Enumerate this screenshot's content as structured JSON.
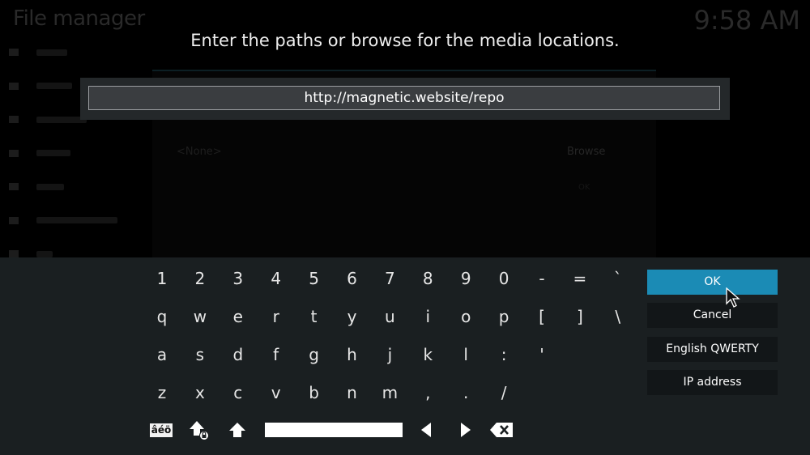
{
  "background": {
    "title": "File manager",
    "clock": "9:58 AM",
    "sidebar_item_count": 7,
    "dialog": {
      "source_value": "<None>",
      "browse_label": "Browse",
      "ok_label": "OK"
    }
  },
  "dialog": {
    "heading": "Enter the paths or browse for the media locations.",
    "input_value": "http://magnetic.website/repo"
  },
  "keyboard": {
    "rows": [
      [
        "1",
        "2",
        "3",
        "4",
        "5",
        "6",
        "7",
        "8",
        "9",
        "0",
        "-",
        "=",
        "`"
      ],
      [
        "q",
        "w",
        "e",
        "r",
        "t",
        "y",
        "u",
        "i",
        "o",
        "p",
        "[",
        "]",
        "\\"
      ],
      [
        "a",
        "s",
        "d",
        "f",
        "g",
        "h",
        "j",
        "k",
        "l",
        ":",
        "'"
      ],
      [
        "z",
        "x",
        "c",
        "v",
        "b",
        "n",
        "m",
        ",",
        ".",
        "/"
      ]
    ],
    "accent_label": "âéö",
    "icons": {
      "caps_lock": "shift-lock-icon",
      "shift": "shift-icon",
      "space": "space-bar",
      "left": "arrow-left-icon",
      "right": "arrow-right-icon",
      "backspace": "backspace-icon"
    }
  },
  "actions": {
    "ok": "OK",
    "cancel": "Cancel",
    "layout": "English QWERTY",
    "ip": "IP address"
  },
  "colors": {
    "accent": "#1b8bb5",
    "panel": "#1a1f21",
    "button": "#121618"
  }
}
